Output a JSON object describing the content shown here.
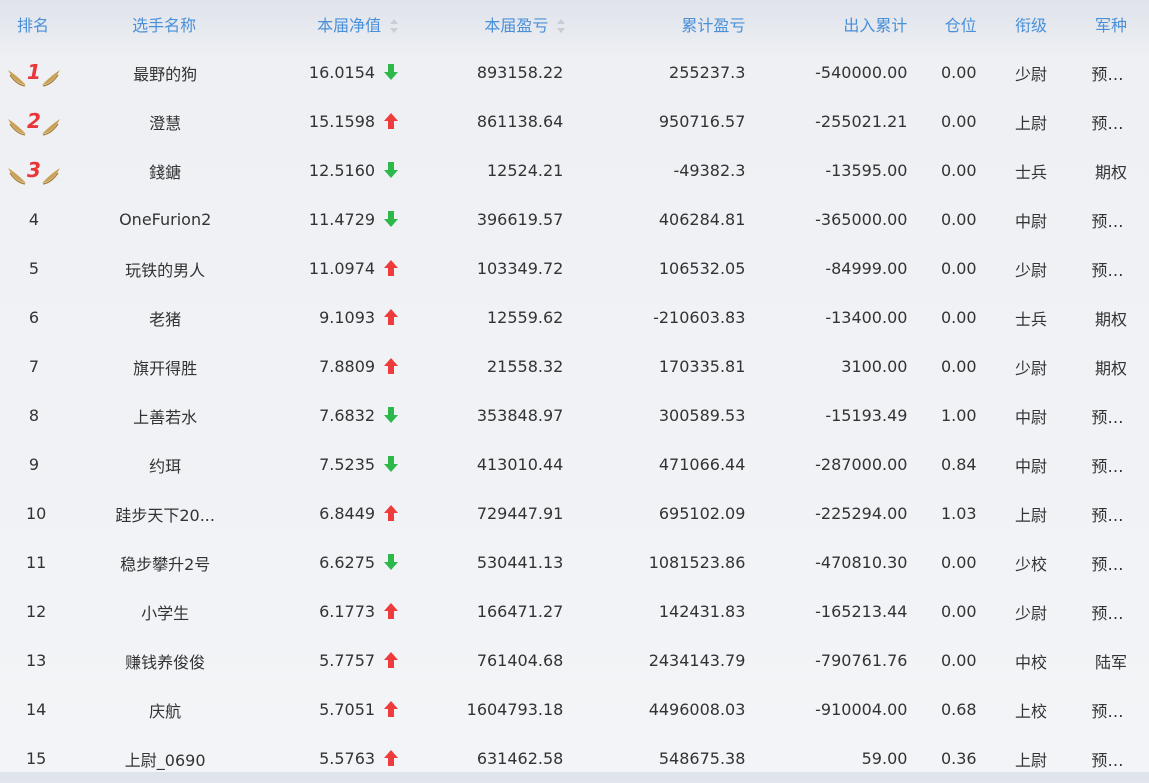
{
  "headers": {
    "rank": "排名",
    "name": "选手名称",
    "nav": "本届净值",
    "profit": "本届盈亏",
    "cum_profit": "累计盈亏",
    "flow": "出入累计",
    "position": "仓位",
    "rank_title": "衔级",
    "arm": "军种"
  },
  "colors": {
    "header_text": "#4a90d9",
    "up_arrow": "#ee3b3b",
    "down_arrow": "#2db84a",
    "medal_number": "#e8373b",
    "medal_wing": "#c9a257"
  },
  "rows": [
    {
      "rank": "1",
      "medal": true,
      "name": "最野的狗",
      "nav": "16.0154",
      "trend": "down",
      "profit": "893158.22",
      "cum_profit": "255237.3",
      "flow": "-540000.00",
      "position": "0.00",
      "rank_title": "少尉",
      "arm": "预备役"
    },
    {
      "rank": "2",
      "medal": true,
      "name": "澄慧",
      "nav": "15.1598",
      "trend": "up",
      "profit": "861138.64",
      "cum_profit": "950716.57",
      "flow": "-255021.21",
      "position": "0.00",
      "rank_title": "上尉",
      "arm": "预备役"
    },
    {
      "rank": "3",
      "medal": true,
      "name": "錢鎕",
      "nav": "12.5160",
      "trend": "down",
      "profit": "12524.21",
      "cum_profit": "-49382.3",
      "flow": "-13595.00",
      "position": "0.00",
      "rank_title": "士兵",
      "arm": "期权"
    },
    {
      "rank": "4",
      "medal": false,
      "name": "OneFurion2",
      "nav": "11.4729",
      "trend": "down",
      "profit": "396619.57",
      "cum_profit": "406284.81",
      "flow": "-365000.00",
      "position": "0.00",
      "rank_title": "中尉",
      "arm": "预备役"
    },
    {
      "rank": "5",
      "medal": false,
      "name": "玩铁的男人",
      "nav": "11.0974",
      "trend": "up",
      "profit": "103349.72",
      "cum_profit": "106532.05",
      "flow": "-84999.00",
      "position": "0.00",
      "rank_title": "少尉",
      "arm": "预备役"
    },
    {
      "rank": "6",
      "medal": false,
      "name": "老猪",
      "nav": "9.1093",
      "trend": "up",
      "profit": "12559.62",
      "cum_profit": "-210603.83",
      "flow": "-13400.00",
      "position": "0.00",
      "rank_title": "士兵",
      "arm": "期权"
    },
    {
      "rank": "7",
      "medal": false,
      "name": "旗开得胜",
      "nav": "7.8809",
      "trend": "up",
      "profit": "21558.32",
      "cum_profit": "170335.81",
      "flow": "3100.00",
      "position": "0.00",
      "rank_title": "少尉",
      "arm": "期权"
    },
    {
      "rank": "8",
      "medal": false,
      "name": "上善若水",
      "nav": "7.6832",
      "trend": "down",
      "profit": "353848.97",
      "cum_profit": "300589.53",
      "flow": "-15193.49",
      "position": "1.00",
      "rank_title": "中尉",
      "arm": "预备役"
    },
    {
      "rank": "9",
      "medal": false,
      "name": "约珥",
      "nav": "7.5235",
      "trend": "down",
      "profit": "413010.44",
      "cum_profit": "471066.44",
      "flow": "-287000.00",
      "position": "0.84",
      "rank_title": "中尉",
      "arm": "预备役"
    },
    {
      "rank": "10",
      "medal": false,
      "name": "跬步天下20...",
      "nav": "6.8449",
      "trend": "up",
      "profit": "729447.91",
      "cum_profit": "695102.09",
      "flow": "-225294.00",
      "position": "1.03",
      "rank_title": "上尉",
      "arm": "预备役"
    },
    {
      "rank": "11",
      "medal": false,
      "name": "稳步攀升2号",
      "nav": "6.6275",
      "trend": "down",
      "profit": "530441.13",
      "cum_profit": "1081523.86",
      "flow": "-470810.30",
      "position": "0.00",
      "rank_title": "少校",
      "arm": "预备役"
    },
    {
      "rank": "12",
      "medal": false,
      "name": "小学生",
      "nav": "6.1773",
      "trend": "up",
      "profit": "166471.27",
      "cum_profit": "142431.83",
      "flow": "-165213.44",
      "position": "0.00",
      "rank_title": "少尉",
      "arm": "预备役"
    },
    {
      "rank": "13",
      "medal": false,
      "name": "赚钱养俊俊",
      "nav": "5.7757",
      "trend": "up",
      "profit": "761404.68",
      "cum_profit": "2434143.79",
      "flow": "-790761.76",
      "position": "0.00",
      "rank_title": "中校",
      "arm": "陆军"
    },
    {
      "rank": "14",
      "medal": false,
      "name": "庆航",
      "nav": "5.7051",
      "trend": "up",
      "profit": "1604793.18",
      "cum_profit": "4496008.03",
      "flow": "-910004.00",
      "position": "0.68",
      "rank_title": "上校",
      "arm": "预备役"
    },
    {
      "rank": "15",
      "medal": false,
      "name": "上尉_0690",
      "nav": "5.5763",
      "trend": "up",
      "profit": "631462.58",
      "cum_profit": "548675.38",
      "flow": "59.00",
      "position": "0.36",
      "rank_title": "上尉",
      "arm": "预备役"
    }
  ]
}
